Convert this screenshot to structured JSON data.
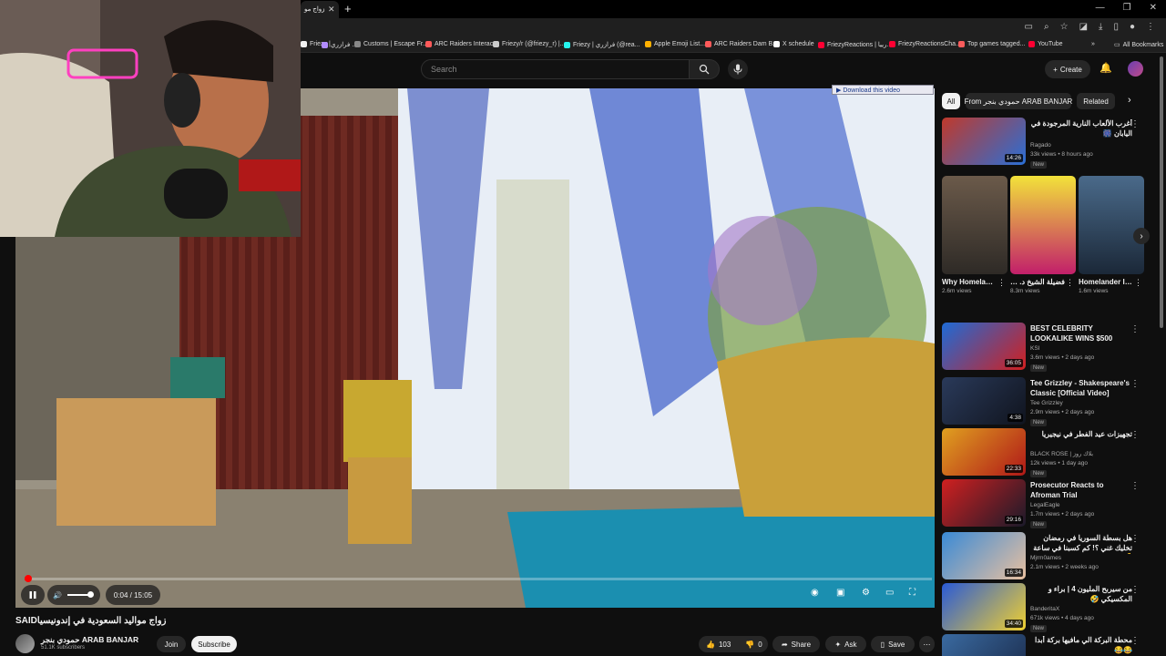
{
  "browser": {
    "active_tab_title": "زواج مو",
    "bookmarks": [
      {
        "label": "Friezy |",
        "color": "#f1f1f1"
      },
      {
        "label": "فرازري ...",
        "color": "#b28cff"
      },
      {
        "label": "Customs | Escape Fr...",
        "color": "#888888"
      },
      {
        "label": "ARC Raiders Interac...",
        "color": "#ff5a5a"
      },
      {
        "label": "Friezy/r (@friezy_r) |...",
        "color": "#cccccc"
      },
      {
        "label": "Friezy | فرازري (@rea...",
        "color": "#25f4ee"
      },
      {
        "label": "Apple Emoji List...",
        "color": "#ffb000"
      },
      {
        "label": "ARC Raiders Dam B...",
        "color": "#ff5a5a"
      },
      {
        "label": "X schedule",
        "color": "#ffffff"
      },
      {
        "label": "FriezyReactions | رييا...",
        "color": "#ff0033"
      },
      {
        "label": "FriezyReactionsCha...",
        "color": "#ff0033"
      },
      {
        "label": "Top games tagged...",
        "color": "#fa5c5c"
      },
      {
        "label": "YouTube",
        "color": "#ff0033"
      }
    ],
    "all_bookmarks": "All Bookmarks"
  },
  "masthead": {
    "search_placeholder": "Search",
    "create_label": "Create"
  },
  "download_banner": "Download this video",
  "player": {
    "time": "0:04 / 15:05",
    "progress_fraction": 0.004,
    "tooltip": "Pause"
  },
  "video": {
    "title": "زواج مواليد السعودية في إندونيسيا",
    "title_suffix": "SAID",
    "channel_name": "حمودي بنجر ARAB BANJAR",
    "subscribers": "51.1K subscribers",
    "join_label": "Join",
    "subscribe_label": "Subscribe",
    "likes": "103",
    "dislikes": "0",
    "share_label": "Share",
    "ask_label": "Ask",
    "save_label": "Save"
  },
  "chips": [
    {
      "label": "All",
      "active": true
    },
    {
      "label": "From حمودي بنجر ARAB BANJAR",
      "active": false
    },
    {
      "label": "Related",
      "active": false
    }
  ],
  "recommendations_top": [
    {
      "title": "أغرب الألعاب النارية المرجودة في اليابان 🎆",
      "channel": "Ragado",
      "meta": "33k views • 8 hours ago",
      "badge": "New",
      "duration": "14:26",
      "color_a": "#c0392b",
      "color_b": "#2a6fd6"
    }
  ],
  "shorts": [
    {
      "title": "Why Homelander...",
      "views": "2.6m views",
      "color_a": "#6b5a4a",
      "color_b": "#2e2a26"
    },
    {
      "title": "فضيلة الشيخ د. عبدالله الجهني ...",
      "views": "8.3m views",
      "color_a": "#f2e23a",
      "color_b": "#c21f6a"
    },
    {
      "title": "Homelander Is Scared O...",
      "views": "1.6m views",
      "color_a": "#4a6a8a",
      "color_b": "#1b2838"
    }
  ],
  "recommendations": [
    {
      "title": "BEST CELEBRITY LOOKALIKE WINS $500",
      "channel": "KSI",
      "meta": "3.6m views • 2 days ago",
      "badge": "New",
      "duration": "36:05",
      "color_a": "#1e6bd6",
      "color_b": "#d12020"
    },
    {
      "title": "Tee Grizzley - Shakespeare's Classic [Official Video]",
      "channel": "Tee Grizzley",
      "meta": "2.9m views • 2 days ago",
      "badge": "New",
      "duration": "4:38",
      "color_a": "#2a3a5a",
      "color_b": "#10141e"
    },
    {
      "title": "تجهيزات عيد الفطر في نيجيريا",
      "channel": "BLACK ROSE | بلاك روز",
      "meta": "12k views • 1 day ago",
      "badge": "New",
      "duration": "22:33",
      "color_a": "#e0a020",
      "color_b": "#b01818"
    },
    {
      "title": "Prosecutor Reacts to Afroman Trial",
      "channel": "LegalEagle",
      "meta": "1.7m views • 2 days ago",
      "badge": "New",
      "duration": "29:16",
      "color_a": "#d02020",
      "color_b": "#1a1a2a"
    },
    {
      "title": "هل بسطة السوريا في رمضان تخليك غني ؟! كم كسبنا في ساعة 💰",
      "channel": "Mjrm0ames",
      "meta": "2.1m views • 2 weeks ago",
      "badge": "",
      "duration": "16:34",
      "color_a": "#3a8ad6",
      "color_b": "#e8c0a0"
    },
    {
      "title": "من سيربح المليون 4 | براء و المكسيكي 🤣",
      "channel": "BanderitaX",
      "meta": "671k views • 4 days ago",
      "badge": "New",
      "duration": "34:40",
      "color_a": "#2a5ad6",
      "color_b": "#f0d030"
    },
    {
      "title": "محطة البركة الي مافيها بركة أبدا 😂😂",
      "channel": "",
      "meta": "",
      "badge": "",
      "duration": "",
      "color_a": "#3a6aa0",
      "color_b": "#1a2a4a"
    }
  ]
}
